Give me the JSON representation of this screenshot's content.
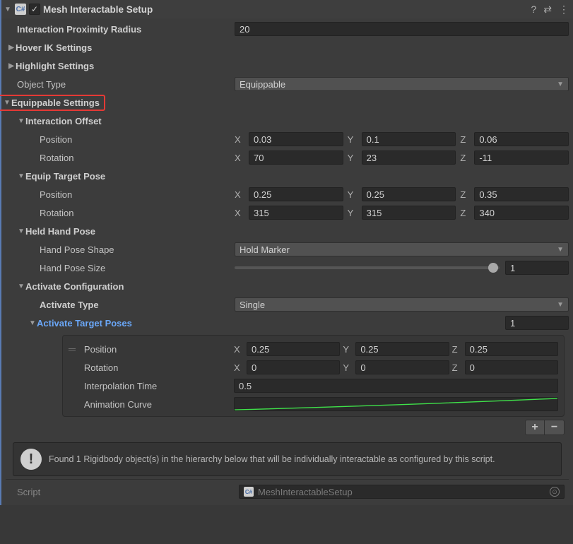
{
  "header": {
    "title": "Mesh Interactable Setup",
    "enabled": true
  },
  "proximity": {
    "label": "Interaction Proximity Radius",
    "value": "20"
  },
  "hoverIK": {
    "label": "Hover IK Settings"
  },
  "highlight": {
    "label": "Highlight Settings"
  },
  "objectType": {
    "label": "Object Type",
    "value": "Equippable"
  },
  "equip": {
    "label": "Equippable Settings",
    "interactionOffset": {
      "label": "Interaction Offset",
      "position": {
        "label": "Position",
        "x": "0.03",
        "y": "0.1",
        "z": "0.06"
      },
      "rotation": {
        "label": "Rotation",
        "x": "70",
        "y": "23",
        "z": "-11"
      }
    },
    "equipTargetPose": {
      "label": "Equip Target Pose",
      "position": {
        "label": "Position",
        "x": "0.25",
        "y": "0.25",
        "z": "0.35"
      },
      "rotation": {
        "label": "Rotation",
        "x": "315",
        "y": "315",
        "z": "340"
      }
    },
    "heldHandPose": {
      "label": "Held Hand Pose",
      "shape": {
        "label": "Hand Pose Shape",
        "value": "Hold Marker"
      },
      "size": {
        "label": "Hand Pose Size",
        "value": "1"
      }
    },
    "activate": {
      "label": "Activate Configuration",
      "type": {
        "label": "Activate Type",
        "value": "Single"
      },
      "poses": {
        "label": "Activate Target Poses",
        "size": "1",
        "items": [
          {
            "position": {
              "label": "Position",
              "x": "0.25",
              "y": "0.25",
              "z": "0.25"
            },
            "rotation": {
              "label": "Rotation",
              "x": "0",
              "y": "0",
              "z": "0"
            },
            "interpTime": {
              "label": "Interpolation Time",
              "value": "0.5"
            },
            "animCurve": {
              "label": "Animation Curve"
            }
          }
        ]
      }
    }
  },
  "info": "Found 1 Rigidbody object(s) in the hierarchy below that will be individually interactable as configured by this script.",
  "script": {
    "label": "Script",
    "value": "MeshInteractableSetup"
  },
  "axis": {
    "x": "X",
    "y": "Y",
    "z": "Z"
  }
}
